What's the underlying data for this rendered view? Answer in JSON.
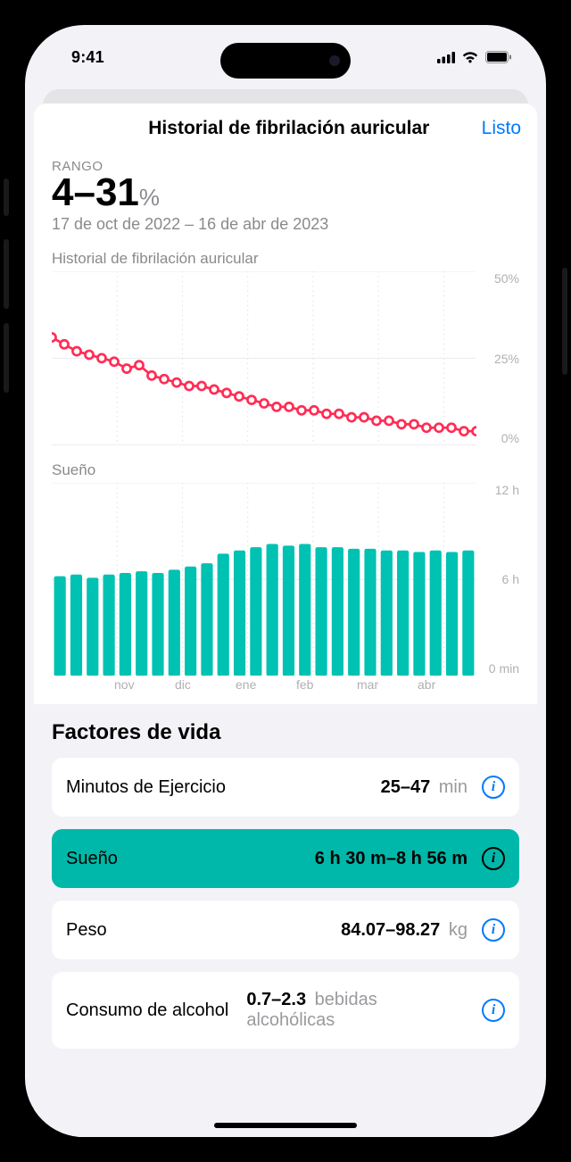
{
  "status": {
    "time": "9:41"
  },
  "nav": {
    "title": "Historial de fibrilación auricular",
    "done": "Listo"
  },
  "summary": {
    "range_label": "RANGO",
    "range_value": "4–31",
    "range_pct": "%",
    "date_range": "17 de oct de 2022 – 16 de abr de 2023"
  },
  "chart_data": [
    {
      "type": "line",
      "title": "Historial de fibrilación auricular",
      "ylabel": "%",
      "ylim": [
        0,
        50
      ],
      "yticks": [
        "50%",
        "25%",
        "0%"
      ],
      "xticks": [
        "",
        "nov",
        "dic",
        "ene",
        "feb",
        "mar",
        "abr"
      ],
      "color": "#ff2d55",
      "values": [
        31,
        29,
        27,
        26,
        25,
        24,
        22,
        23,
        20,
        19,
        18,
        17,
        17,
        16,
        15,
        14,
        13,
        12,
        11,
        11,
        10,
        10,
        9,
        9,
        8,
        8,
        7,
        7,
        6,
        6,
        5,
        5,
        5,
        4,
        4
      ]
    },
    {
      "type": "bar",
      "title": "Sueño",
      "ylabel": "h",
      "ylim": [
        0,
        12
      ],
      "yticks": [
        "12 h",
        "6 h",
        "0 min"
      ],
      "xticks": [
        "",
        "nov",
        "dic",
        "ene",
        "feb",
        "mar",
        "abr"
      ],
      "color": "#00c2b2",
      "values": [
        6.2,
        6.3,
        6.1,
        6.3,
        6.4,
        6.5,
        6.4,
        6.6,
        6.8,
        7.0,
        7.6,
        7.8,
        8.0,
        8.2,
        8.1,
        8.2,
        8.0,
        8.0,
        7.9,
        7.9,
        7.8,
        7.8,
        7.7,
        7.8,
        7.7,
        7.8
      ]
    }
  ],
  "factors": {
    "heading": "Factores de vida",
    "items": [
      {
        "name": "Minutos de Ejercicio",
        "value": "25–47",
        "unit": "min",
        "active": false
      },
      {
        "name": "Sueño",
        "value": "6 h 30 m–8 h 56 m",
        "unit": "",
        "active": true
      },
      {
        "name": "Peso",
        "value": "84.07–98.27",
        "unit": "kg",
        "active": false
      },
      {
        "name": "Consumo de alcohol",
        "value": "0.7–2.3",
        "unit": "bebidas alcohólicas",
        "active": false
      }
    ]
  }
}
